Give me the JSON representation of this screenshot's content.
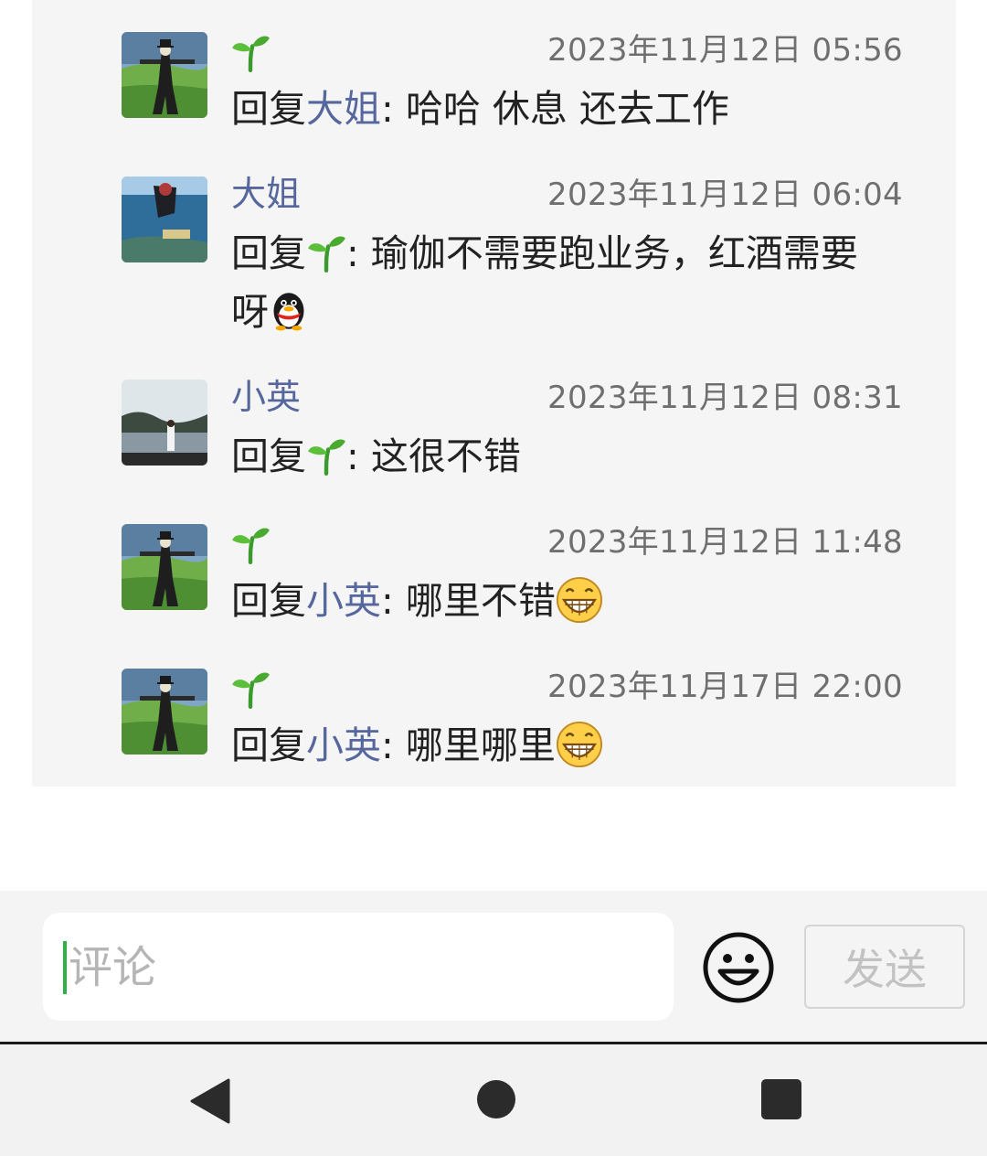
{
  "comments": [
    {
      "author": "",
      "author_is_icon": true,
      "time": "2023年11月12日 05:56",
      "prefix": "回复",
      "reply_to": "大姐",
      "sep": ": ",
      "text": "哈哈 休息 还去工作",
      "avatar": "scarecrow-field"
    },
    {
      "author": "大姐",
      "author_is_icon": false,
      "time": "2023年11月12日 06:04",
      "prefix": "回复",
      "reply_to_icon": "sprout-icon",
      "sep": ": ",
      "text": "瑜伽不需要跑业务，红酒需要",
      "text2": "呀",
      "trailing_icon": "qq-penguin-emoji",
      "avatar": "underwater-diver"
    },
    {
      "author": "小英",
      "author_is_icon": false,
      "time": "2023年11月12日 08:31",
      "prefix": "回复",
      "reply_to_icon": "sprout-icon",
      "sep": ": ",
      "text": "这很不错",
      "avatar": "lake-portrait"
    },
    {
      "author": "",
      "author_is_icon": true,
      "time": "2023年11月12日 11:48",
      "prefix": "回复",
      "reply_to": "小英",
      "sep": ": ",
      "text": "哪里不错",
      "trailing_icon": "grin-emoji",
      "avatar": "scarecrow-field"
    },
    {
      "author": "",
      "author_is_icon": true,
      "time": "2023年11月17日 22:00",
      "prefix": "回复",
      "reply_to": "小英",
      "sep": ": ",
      "text": "哪里哪里",
      "trailing_icon": "grin-emoji",
      "avatar": "scarecrow-field"
    }
  ],
  "composer": {
    "placeholder": "评论",
    "send_label": "发送",
    "emoji_icon": "smiley-icon"
  },
  "navbar": {
    "icons": [
      "back-triangle-icon",
      "home-circle-icon",
      "recents-square-icon"
    ]
  },
  "colors": {
    "name_link": "#55679c",
    "timestamp": "#6f6f6f",
    "panel_bg": "#f5f5f5",
    "caret": "#2db24a"
  }
}
